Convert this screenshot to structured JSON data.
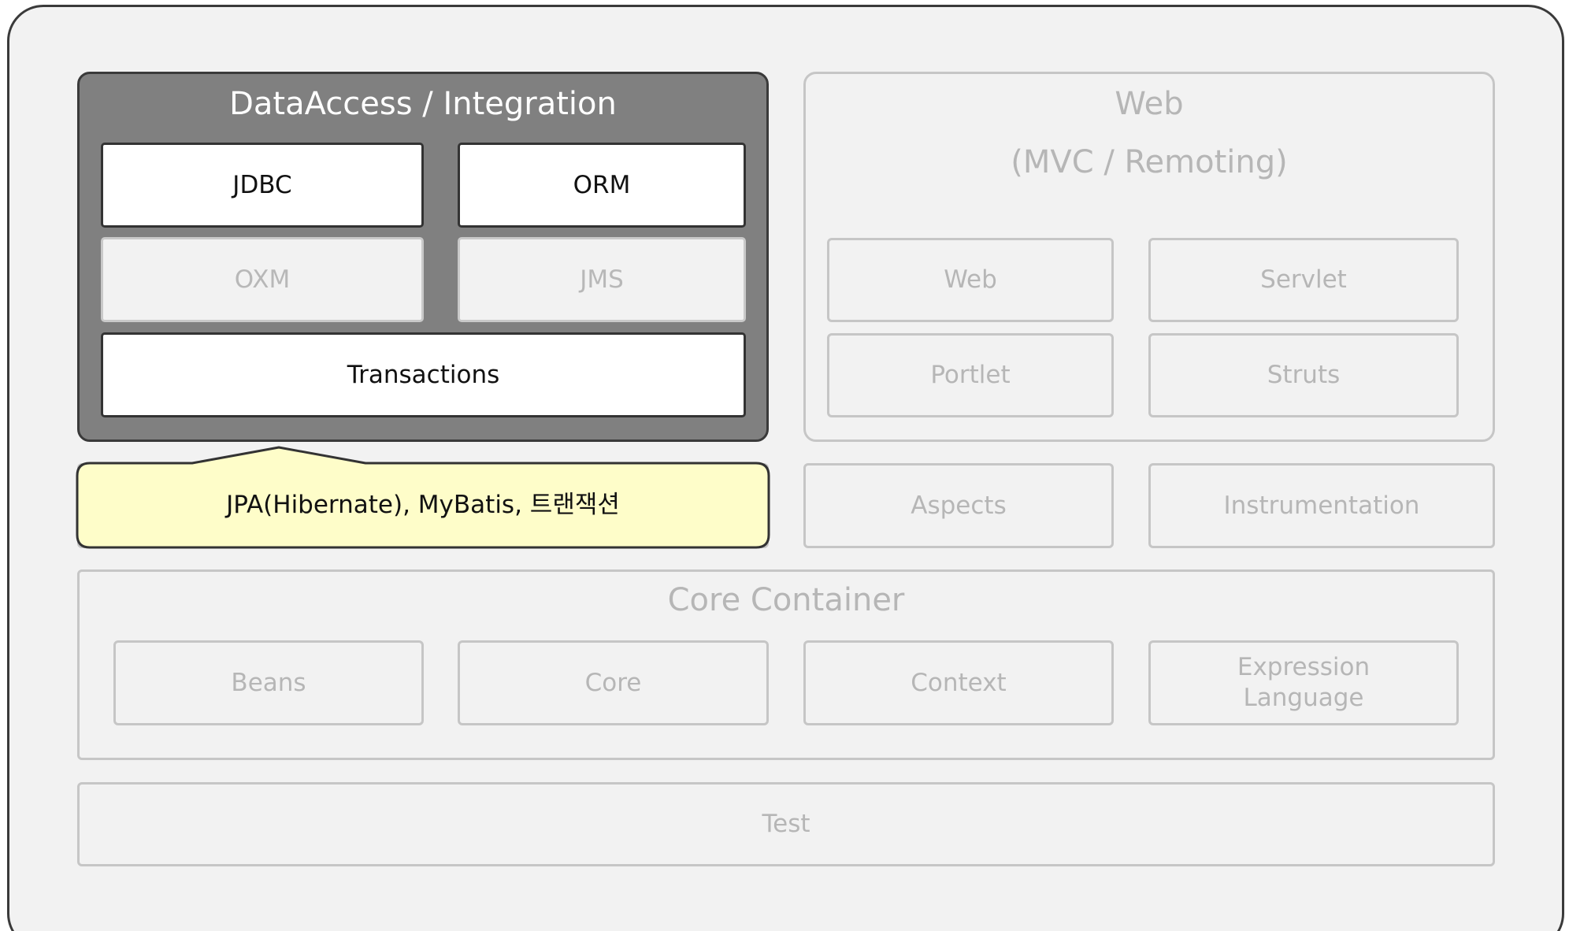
{
  "data_access": {
    "title": "DataAccess / Integration",
    "modules": {
      "jdbc": "JDBC",
      "orm": "ORM",
      "oxm": "OXM",
      "jms": "JMS",
      "transactions": "Transactions"
    }
  },
  "callout": {
    "text": "JPA(Hibernate), MyBatis, 트랜잭션"
  },
  "web": {
    "title_line1": "Web",
    "title_line2": "(MVC / Remoting)",
    "modules": {
      "web": "Web",
      "servlet": "Servlet",
      "portlet": "Portlet",
      "struts": "Struts"
    }
  },
  "aspects": "Aspects",
  "instrumentation": "Instrumentation",
  "core_container": {
    "title": "Core Container",
    "modules": {
      "beans": "Beans",
      "core": "Core",
      "context": "Context",
      "expression_line1": "Expression",
      "expression_line2": "Language"
    }
  },
  "test": "Test",
  "colors": {
    "highlight_panel": "#808080",
    "callout_fill": "#fefdc9",
    "faded_text": "#b6b6b6",
    "background": "#f2f2f2"
  }
}
